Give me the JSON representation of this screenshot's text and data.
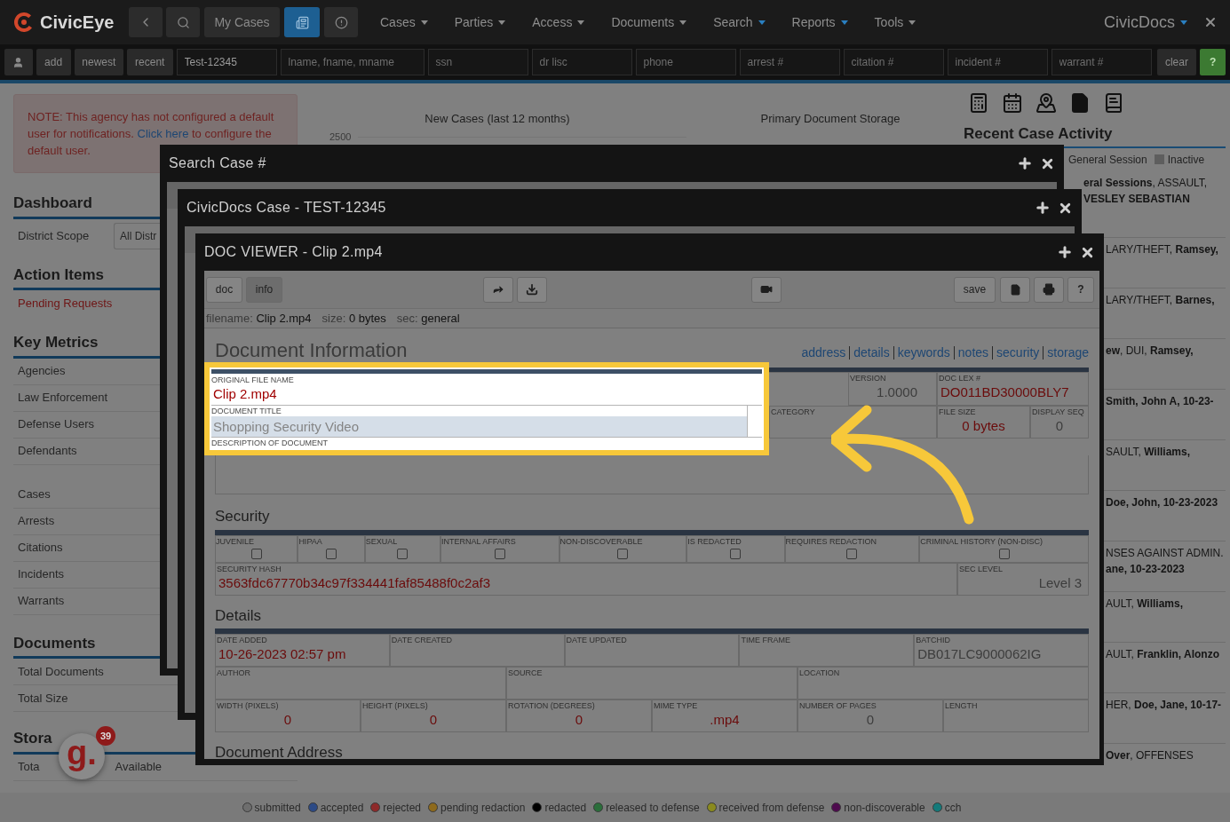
{
  "nav": {
    "logo": "CivicEye",
    "my_cases": "My Cases",
    "doc_button_selected": true,
    "menus": [
      {
        "label": "Cases",
        "accent": false
      },
      {
        "label": "Parties",
        "accent": false
      },
      {
        "label": "Access",
        "accent": false
      },
      {
        "label": "Documents",
        "accent": false
      },
      {
        "label": "Search",
        "accent": true
      },
      {
        "label": "Reports",
        "accent": true
      },
      {
        "label": "Tools",
        "accent": false
      }
    ],
    "app_menu": "CivicDocs"
  },
  "quick_search": {
    "buttons": [
      "add",
      "newest",
      "recent"
    ],
    "fields": [
      {
        "value": "Test-12345"
      },
      {
        "placeholder": "lname, fname, mname"
      },
      {
        "placeholder": "ssn"
      },
      {
        "placeholder": "dr lisc"
      },
      {
        "placeholder": "phone"
      },
      {
        "placeholder": "arrest #"
      },
      {
        "placeholder": "citation #"
      },
      {
        "placeholder": "incident #"
      },
      {
        "placeholder": "warrant #"
      }
    ],
    "clear": "clear",
    "help": "?"
  },
  "notice": {
    "before": "NOTE: This agency has not configured a default user for notifications.",
    "link": "Click here",
    "after": "to configure the default user."
  },
  "dashboard": {
    "heading": "Dashboard",
    "scope_label": "District Scope",
    "scope_value": "All Distr"
  },
  "action_items": {
    "heading": "Action Items",
    "items": [
      "Pending Requests"
    ]
  },
  "key_metrics": {
    "heading": "Key Metrics",
    "groups": [
      [
        "Agencies",
        "Law Enforcement",
        "Defense Users",
        "Defendants"
      ],
      [
        "Cases",
        "Arrests",
        "Citations",
        "Incidents",
        "Warrants"
      ]
    ]
  },
  "documents": {
    "heading": "Documents",
    "items": [
      "Total Documents",
      "Total Size"
    ]
  },
  "storage": {
    "heading": "Stora",
    "row": [
      "Tota",
      "Available"
    ]
  },
  "chat_badge": {
    "logo": "g.",
    "count": "39"
  },
  "charts": {
    "new_cases_title": "New Cases (last 12 months)",
    "new_cases_tick": "2500",
    "storage_title": "Primary Document Storage"
  },
  "recent_activity": {
    "heading": "Recent Case Activity",
    "legend": [
      "General Session",
      "Inactive"
    ],
    "items": [
      {
        "lines": [
          "**eral Sessions**, ASSAULT,",
          "**VESLEY SEBASTIAN**"
        ]
      },
      {
        "lines": [
          "LARY/THEFT, **Ramsey,**"
        ]
      },
      {
        "lines": [
          "LARY/THEFT, **Barnes,**"
        ]
      },
      {
        "lines": [
          "**ew**, DUI, **Ramsey,**"
        ]
      },
      {
        "lines": [
          "**Smith, John A, 10-23-**"
        ]
      },
      {
        "lines": [
          "SAULT, **Williams,**"
        ]
      },
      {
        "lines": [
          "**Doe, John, 10-23-2023**"
        ]
      },
      {
        "lines": [
          "NSES AGAINST ADMIN.",
          "**ane, 10-23-2023**"
        ]
      },
      {
        "lines": [
          "AULT, **Williams,**"
        ]
      },
      {
        "lines": [
          "AULT, **Franklin, Alonzo**"
        ]
      },
      {
        "lines": [
          "HER, **Doe, Jane, 10-17-**"
        ]
      },
      {
        "lines": [
          "**Over**, OFFENSES"
        ]
      }
    ]
  },
  "windows": [
    {
      "title": "Search Case #"
    },
    {
      "title": "CivicDocs Case - TEST-12345"
    }
  ],
  "doc_viewer": {
    "title": "DOC VIEWER - Clip 2.mp4",
    "tabs": [
      {
        "label": "doc",
        "selected": false
      },
      {
        "label": "info",
        "selected": true
      }
    ],
    "save": "save",
    "help": "?",
    "info": [
      {
        "label": "filename:",
        "value": "Clip 2.mp4"
      },
      {
        "label": "size:",
        "value": "0 bytes"
      },
      {
        "label": "sec:",
        "value": "general"
      }
    ],
    "heading": "Document Information",
    "links": [
      "address",
      "details",
      "keywords",
      "notes",
      "security",
      "storage"
    ],
    "file_name": {
      "label": "ORIGINAL FILE NAME",
      "value": "Clip 2.mp4"
    },
    "title_field": {
      "label": "DOCUMENT TITLE",
      "value": "Shopping Security Video"
    },
    "description_label": "DESCRIPTION OF DOCUMENT",
    "version": {
      "label": "VERSION",
      "value": "1.0000",
      "color": "#3c3c3c"
    },
    "doc_lex": {
      "label": "DOC LEX #",
      "value": "DO011BD30000BLY7",
      "color": "#6a0b0b"
    },
    "category": {
      "label": "CATEGORY"
    },
    "file_size": {
      "label": "FILE SIZE",
      "value": "0 bytes",
      "color": "#6a0b0b"
    },
    "display_seq": {
      "label": "DISPLAY SEQ",
      "value": "0",
      "color": "#3c3c3c"
    },
    "security_heading": "Security",
    "flags": [
      {
        "label": "JUVENILE",
        "checked": false
      },
      {
        "label": "HIPAA",
        "checked": false
      },
      {
        "label": "SEXUAL",
        "checked": false
      },
      {
        "label": "INTERNAL AFFAIRS",
        "checked": false
      },
      {
        "label": "NON-DISCOVERABLE",
        "checked": false
      },
      {
        "label": "IS REDACTED",
        "checked": false
      },
      {
        "label": "REQUIRES REDACTION",
        "checked": false
      },
      {
        "label": "CRIMINAL HISTORY (NON-DISC)",
        "checked": false
      }
    ],
    "hash": {
      "label": "SECURITY HASH",
      "value": "3563fdc67770b34c97f334441faf85488f0c2af3",
      "color": "#6a0b0b"
    },
    "sec_level": {
      "label": "SEC LEVEL",
      "value": "Level 3",
      "color": "#3c3c3c"
    },
    "details_heading": "Details",
    "detail_rows": [
      [
        {
          "label": "DATE ADDED",
          "value": "10-26-2023 02:57 pm",
          "color": "#6a0b0b"
        },
        {
          "label": "DATE CREATED"
        },
        {
          "label": "DATE UPDATED"
        },
        {
          "label": "TIME FRAME"
        },
        {
          "label": "BATCHID",
          "value": "DB017LC9000062IG",
          "color": "#3c3c3c"
        }
      ],
      [
        {
          "label": "AUTHOR"
        },
        {
          "label": "SOURCE"
        },
        {
          "label": "LOCATION"
        }
      ],
      [
        {
          "label": "WIDTH (PIXELS)",
          "value": "0",
          "color": "#6a0b0b"
        },
        {
          "label": "HEIGHT (PIXELS)",
          "value": "0",
          "color": "#6a0b0b"
        },
        {
          "label": "ROTATION (DEGREES)",
          "value": "0",
          "color": "#6a0b0b"
        },
        {
          "label": "MIME TYPE",
          "value": ".mp4",
          "color": "#6a0b0b"
        },
        {
          "label": "NUMBER OF PAGES",
          "value": "0",
          "color": "#3c3c3c"
        },
        {
          "label": "LENGTH"
        }
      ]
    ],
    "address_heading": "Document Address"
  },
  "legend": [
    {
      "label": "submitted",
      "color": "#6e6e6e"
    },
    {
      "label": "accepted",
      "color": "#2c4a86"
    },
    {
      "label": "rejected",
      "color": "#8e2a2a"
    },
    {
      "label": "pending redaction",
      "color": "#8e6a1c"
    },
    {
      "label": "redacted",
      "color": "#000000"
    },
    {
      "label": "released to defense",
      "color": "#2a6e3a"
    },
    {
      "label": "received from defense",
      "color": "#8a8a1e"
    },
    {
      "label": "non-discoverable",
      "color": "#4e0a4e"
    },
    {
      "label": "cch",
      "color": "#137a7a"
    }
  ]
}
